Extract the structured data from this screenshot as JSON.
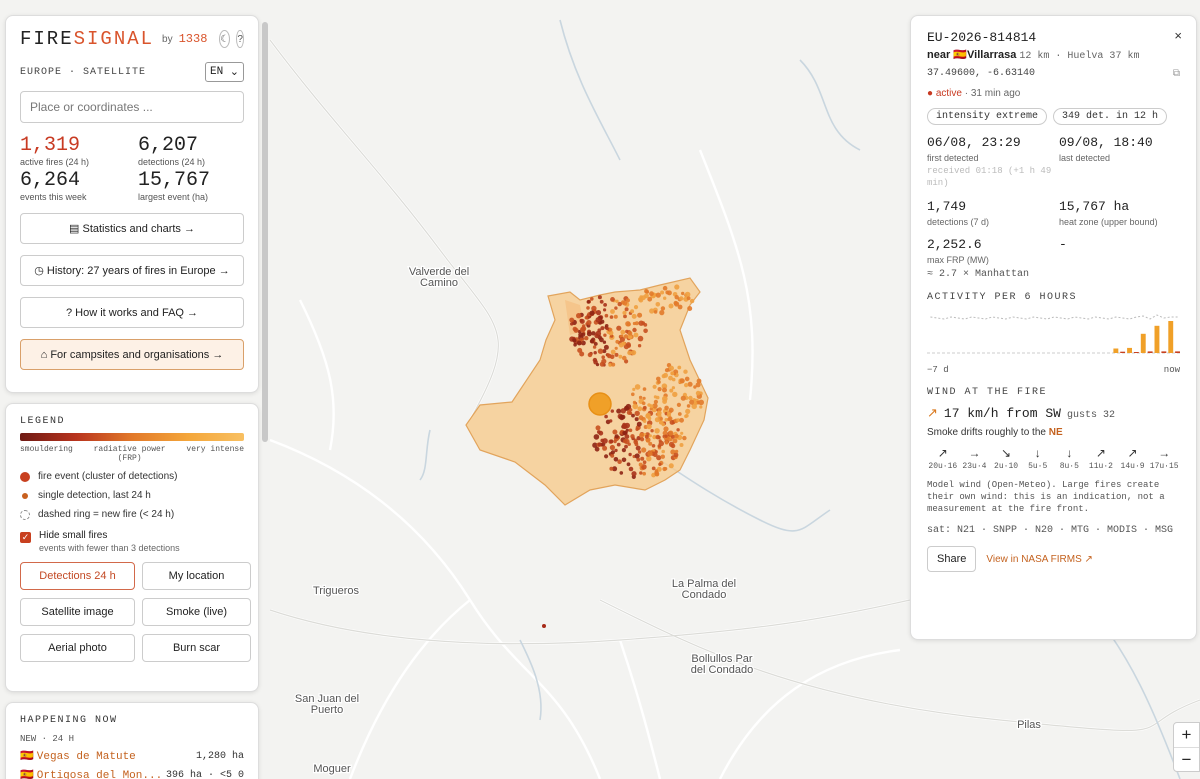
{
  "map": {
    "places": [
      {
        "name": "Valverde del",
        "name2": "Camino"
      },
      {
        "name": "Trigueros",
        "name2": ""
      },
      {
        "name": "La Palma del",
        "name2": "Condado"
      },
      {
        "name": "Bollullos Par",
        "name2": "del Condado"
      },
      {
        "name": "San Juan del",
        "name2": "Puerto"
      },
      {
        "name": "Moguer",
        "name2": ""
      },
      {
        "name": "Pilas",
        "name2": ""
      }
    ],
    "colors": {
      "burn_zone": "#f6c98a",
      "event_center": "#f0a028",
      "detection_dark": "#8e2414",
      "detection_light": "#f0a040"
    }
  },
  "brand": {
    "logo_a": "FIRE",
    "logo_b": "SIGNAL",
    "by": "by",
    "by_num": "1338",
    "btn_theme": "☾",
    "btn_help": "?"
  },
  "region": "EUROPE · SATELLITE",
  "language": "EN",
  "search_placeholder": "Place or coordinates ...",
  "stats": [
    {
      "value": "1,319",
      "label": "active fires (24 h)"
    },
    {
      "value": "6,207",
      "label": "detections (24 h)"
    },
    {
      "value": "6,264",
      "label": "events this week"
    },
    {
      "value": "15,767",
      "label": "largest event (ha)"
    }
  ],
  "main_buttons": [
    "▤ Statistics and charts →",
    "◷ History: 27 years of fires in Europe →",
    "? How it works and FAQ →",
    "⌂ For campsites and organisations →"
  ],
  "legend": {
    "title": "LEGEND",
    "grad_left": "smouldering",
    "grad_mid": "radiative power",
    "grad_mid2": "(FRP)",
    "grad_right": "very intense",
    "items": [
      "fire event (cluster of detections)",
      "single detection, last 24 h",
      "dashed ring = new fire (< 24 h)"
    ],
    "checkbox_label": "Hide small fires",
    "checkbox_sub": "events with fewer than 3 detections",
    "buttons": [
      "Detections 24 h",
      "My location",
      "Satellite image",
      "Smoke (live)",
      "Aerial photo",
      "Burn scar"
    ]
  },
  "now": {
    "title": "HAPPENING NOW",
    "sub": "NEW · 24 H",
    "rows": [
      {
        "flag": "🇪🇸",
        "name": "Vegas de Matute",
        "value": "1,280 ha"
      },
      {
        "flag": "🇪🇸",
        "name": "Ortigosa del Mon...",
        "value": "396 ha · <5 0"
      }
    ]
  },
  "detail": {
    "close": "×",
    "id": "EU-2026-814814",
    "near_prefix": "near",
    "flag": "🇪🇸",
    "place": "Villarrasa",
    "distances": "12 km · Huelva 37 km",
    "coords": "37.49600, -6.63140",
    "copy_icon": "⧉",
    "status_word": "● active",
    "status_rest": " · 31 min ago",
    "tags": [
      "intensity extreme",
      "349 det. in 12 h"
    ],
    "first_detected": "06/08, 23:29",
    "first_detected_lbl": "first detected",
    "received": "received 01:18 (+1 h 49 min)",
    "last_detected": "09/08, 18:40",
    "last_detected_lbl": "last detected",
    "detections_7d": "1,749",
    "detections_7d_lbl": "detections (7 d)",
    "heat_zone": "15,767 ha",
    "heat_zone_lbl": "heat zone (upper bound)",
    "max_frp": "2,252.6",
    "max_frp_lbl": "max FRP (MW)",
    "dash": "-",
    "approx": "≈ 2.7 × Manhattan",
    "activity_title": "ACTIVITY PER 6 HOURS",
    "activity_left": "−7 d",
    "activity_right": "now",
    "wind_title": "WIND AT THE FIRE",
    "wind_arrow": "↗",
    "wind_text": "17 km/h from SW",
    "gusts": "gusts 32",
    "smoke_text": "Smoke drifts roughly to the",
    "smoke_dir": "NE",
    "forecast": [
      {
        "arrow": "↗",
        "label": "20u·16"
      },
      {
        "arrow": "→",
        "label": "23u·4"
      },
      {
        "arrow": "↘",
        "label": "2u·10"
      },
      {
        "arrow": "↓",
        "label": "5u·5"
      },
      {
        "arrow": "↓",
        "label": "8u·5"
      },
      {
        "arrow": "↗",
        "label": "11u·2"
      },
      {
        "arrow": "↗",
        "label": "14u·9"
      },
      {
        "arrow": "→",
        "label": "17u·15"
      }
    ],
    "note": "Model wind (Open-Meteo). Large fires create their own wind: this is an indication, not a measurement at the fire front.",
    "sat": "sat: N21 · SNPP · N20 · MTG · MODIS · MSG",
    "share": "Share",
    "firms": "View in NASA FIRMS ↗"
  },
  "chart_data": {
    "type": "bar",
    "title": "ACTIVITY PER 6 HOURS",
    "xlabel": "",
    "ylabel": "",
    "x_range": [
      "−7 d",
      "now"
    ],
    "series": [
      {
        "values": [
          0,
          0,
          0,
          0,
          0,
          0,
          0,
          0,
          0,
          0,
          0,
          0,
          0,
          0,
          0,
          0,
          0,
          0,
          0,
          0,
          0,
          0,
          0,
          0,
          0,
          0,
          0,
          0.14,
          0.04,
          0.16,
          0.03,
          0.6,
          0.05,
          0.85,
          0.05,
          1.0,
          0.05
        ]
      }
    ],
    "colors": {
      "dark": "#c8401f",
      "light": "#f0a028",
      "baseline": "#cccccc"
    }
  },
  "zoom": {
    "in": "+",
    "out": "−"
  }
}
